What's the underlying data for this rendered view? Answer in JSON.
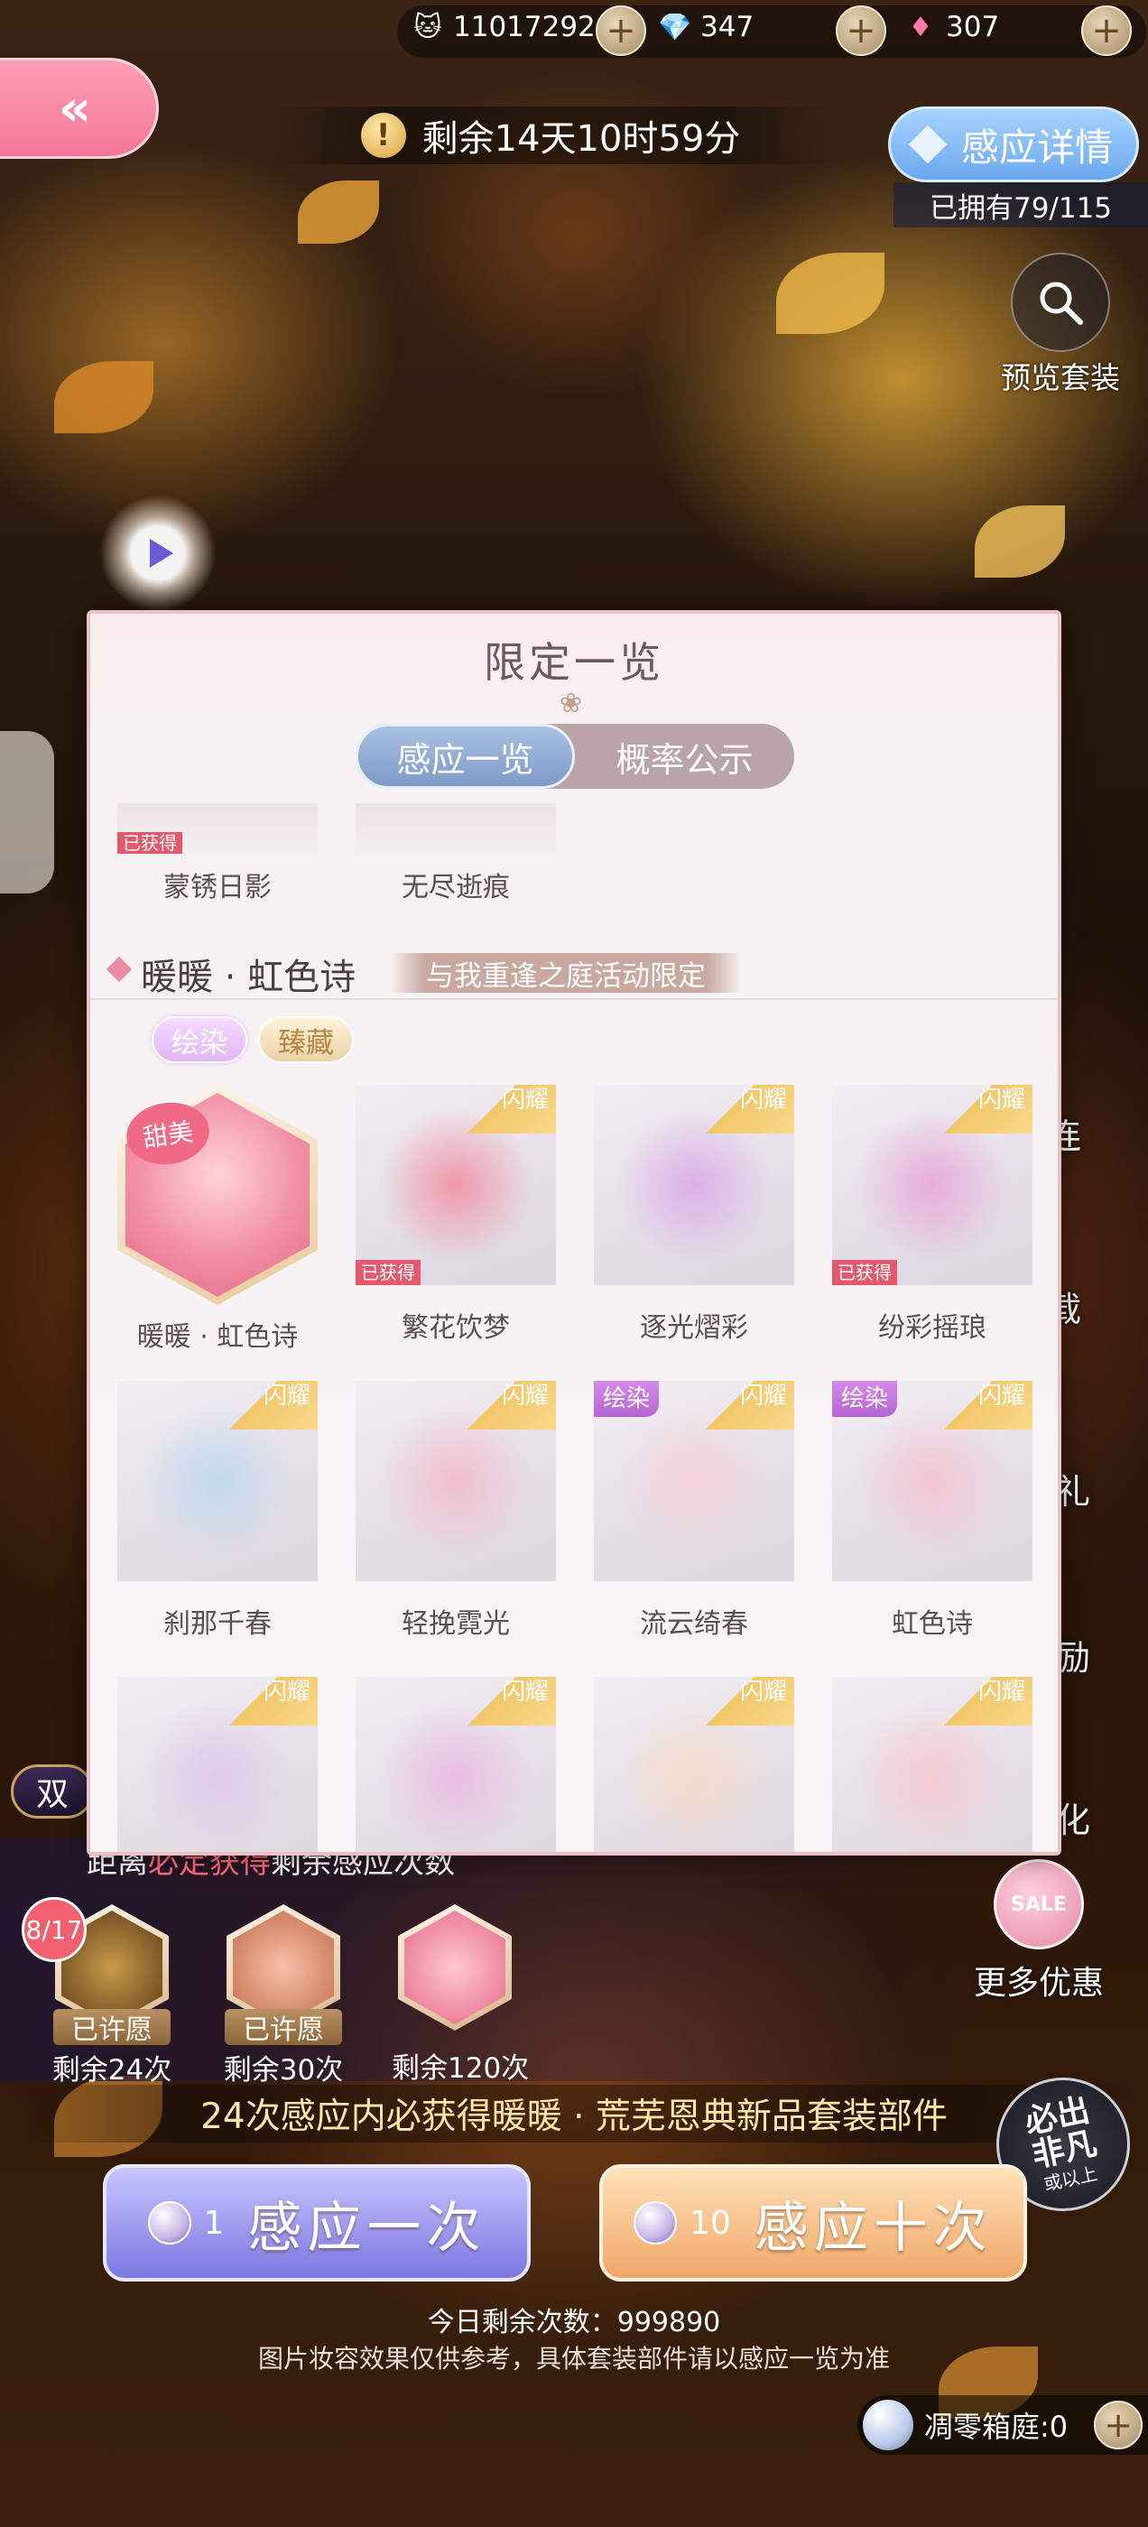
{
  "currency": [
    {
      "icon": "cat-coin-icon",
      "value": "11017292"
    },
    {
      "icon": "purple-diamond-icon",
      "value": "347"
    },
    {
      "icon": "pink-diamond-icon",
      "value": "307"
    }
  ],
  "currency_plus": "+",
  "back_label": "«",
  "timer": {
    "icon": "!",
    "text": "剩余14天10时59分"
  },
  "detail_button": "感应详情",
  "owned": "已拥有79/115",
  "preview": "预览套装",
  "side_menu": [
    "连",
    "载",
    "礼",
    "励",
    "化"
  ],
  "more_deals": {
    "label": "更多优惠",
    "badge": "SALE"
  },
  "double_badge": "双",
  "pity": {
    "title_pre": "距离",
    "title_hl": "必定获得",
    "title_post": "剩余感应次数",
    "count": "8/17",
    "items": [
      {
        "status": "已许愿",
        "remain": "剩余24次"
      },
      {
        "status": "已许愿",
        "remain": "剩余30次"
      },
      {
        "status": "",
        "remain": "剩余120次"
      }
    ]
  },
  "guarantee": "24次感应内必获得暖暖 · 荒芜恩典新品套装部件",
  "seal": {
    "line1": "必出",
    "line2": "非凡",
    "line3": "或以上"
  },
  "draw_one": {
    "count": "1",
    "label": "感应一次"
  },
  "draw_ten": {
    "count": "10",
    "label": "感应十次"
  },
  "today": "今日剩余次数：999890",
  "disclaimer": "图片妆容效果仅供参考，具体套装部件请以感应一览为准",
  "box_garden": {
    "label": "凋零箱庭:0",
    "plus": "+"
  },
  "modal": {
    "title": "限定一览",
    "deco": "❀",
    "tabs": [
      "感应一览",
      "概率公示"
    ],
    "cropped_items": [
      {
        "name": "蒙锈日影",
        "got": "已获得"
      },
      {
        "name": "无尽逝痕"
      }
    ],
    "section": {
      "name": "暖暖 · 虹色诗",
      "tag": "与我重逢之庭活动限定",
      "pills": [
        "绘染",
        "臻藏"
      ]
    },
    "hero": {
      "name": "暖暖 · 虹色诗",
      "badge": "甜美"
    },
    "corner_label": "闪耀",
    "got_label": "已获得",
    "dye_label": "绘染",
    "items": [
      {
        "name": "繁花饮梦",
        "got": true,
        "dye": false,
        "color": "#f08ba0"
      },
      {
        "name": "逐光熠彩",
        "got": false,
        "dye": false,
        "color": "#d9a6e8"
      },
      {
        "name": "纷彩摇琅",
        "got": true,
        "dye": false,
        "color": "#e6a2d8"
      },
      {
        "name": "刹那千春",
        "got": false,
        "dye": false,
        "color": "#b9d7ef"
      },
      {
        "name": "轻挽霓光",
        "got": false,
        "dye": false,
        "color": "#f2b7c8"
      },
      {
        "name": "流云绮春",
        "got": false,
        "dye": true,
        "color": "#f6cfd6"
      },
      {
        "name": "虹色诗",
        "got": false,
        "dye": true,
        "color": "#f4c0cf"
      },
      {
        "name": "",
        "got": false,
        "dye": false,
        "color": "#ddc4ec"
      },
      {
        "name": "",
        "got": false,
        "dye": false,
        "color": "#e8b6e2"
      },
      {
        "name": "",
        "got": false,
        "dye": false,
        "color": "#fad9c6"
      },
      {
        "name": "",
        "got": false,
        "dye": false,
        "color": "#f7c6cc"
      }
    ]
  }
}
